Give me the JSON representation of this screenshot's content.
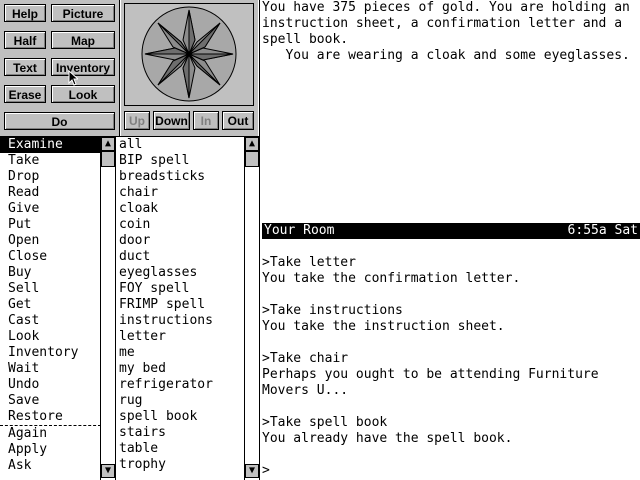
{
  "buttons": {
    "help": "Help",
    "picture": "Picture",
    "half": "Half",
    "map": "Map",
    "text": "Text",
    "inventory": "Inventory",
    "erase": "Erase",
    "look": "Look",
    "do": "Do"
  },
  "nav": {
    "up": "Up",
    "down": "Down",
    "in": "In",
    "out": "Out"
  },
  "verbs": [
    "Examine",
    "Take",
    "Drop",
    "Read",
    "Give",
    "Put",
    "Open",
    "Close",
    "Buy",
    "Sell",
    "Get",
    "Cast",
    "Look",
    "Inventory",
    "Wait",
    "Undo",
    "Save",
    "Restore",
    "Again",
    "Apply",
    "Ask"
  ],
  "verbs_selected": "Examine",
  "nouns": [
    "all",
    "BIP spell",
    "breadsticks",
    "chair",
    "cloak",
    "coin",
    "door",
    "duct",
    "eyeglasses",
    "FOY spell",
    "FRIMP spell",
    "instructions",
    "letter",
    "me",
    "my bed",
    "refrigerator",
    "rug",
    "spell book",
    "stairs",
    "table",
    "trophy"
  ],
  "description": {
    "line1": "You have 375 pieces of gold. You are holding an",
    "line2": "instruction sheet, a confirmation letter and a",
    "line3": "spell book.",
    "line4": "   You are wearing a cloak and some eyeglasses."
  },
  "status": {
    "room": "Your Room",
    "time": "6:55a Sat"
  },
  "transcript": [
    ">Take letter",
    "You take the confirmation letter.",
    "",
    ">Take instructions",
    "You take the instruction sheet.",
    "",
    ">Take chair",
    "Perhaps you ought to be attending Furniture",
    "Movers U...",
    "",
    ">Take spell book",
    "You already have the spell book.",
    "",
    ">"
  ],
  "colors": {
    "panel": "#c0c0c0",
    "compass_star": "#8c8c8c",
    "selected_bg": "#000000"
  }
}
